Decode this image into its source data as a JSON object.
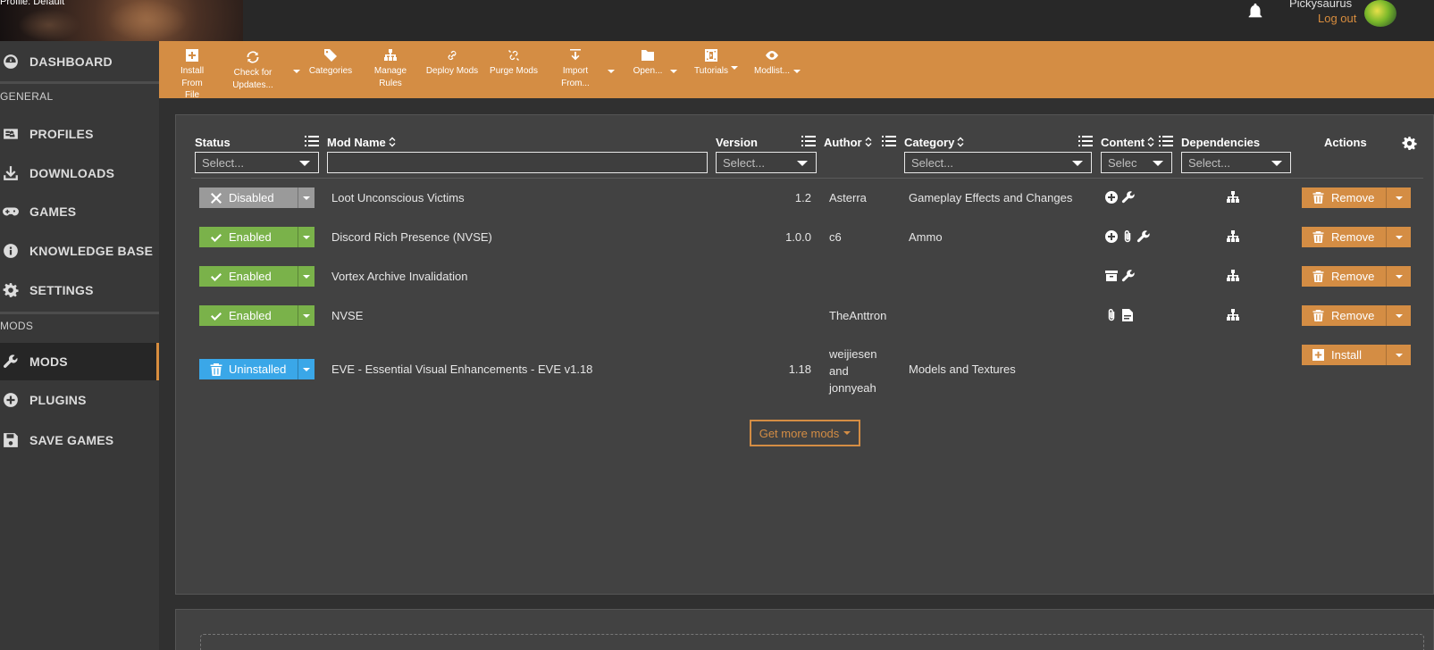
{
  "header": {
    "profile_label": "Profile: Default",
    "username": "Pickysaurus",
    "logout": "Log out"
  },
  "sidebar": {
    "items": [
      {
        "label": "DASHBOARD",
        "icon": "dashboard-icon"
      },
      {
        "label": "PROFILES",
        "icon": "profiles-icon"
      },
      {
        "label": "DOWNLOADS",
        "icon": "download-icon"
      },
      {
        "label": "GAMES",
        "icon": "gamepad-icon"
      },
      {
        "label": "KNOWLEDGE BASE",
        "icon": "info-icon"
      },
      {
        "label": "SETTINGS",
        "icon": "gear-icon"
      },
      {
        "label": "MODS",
        "icon": "wrench-icon",
        "active": true
      },
      {
        "label": "PLUGINS",
        "icon": "plus-circle-icon"
      },
      {
        "label": "SAVE GAMES",
        "icon": "floppy-icon"
      }
    ],
    "sections": {
      "general": "GENERAL",
      "mods": "MODS"
    }
  },
  "toolbar": {
    "install_from_file": [
      "Install From",
      "File"
    ],
    "check_for_updates": [
      "Check for",
      "Updates..."
    ],
    "categories": "Categories",
    "manage_rules": [
      "Manage",
      "Rules"
    ],
    "deploy_mods": "Deploy Mods",
    "purge_mods": "Purge Mods",
    "import_from": [
      "Import",
      "From..."
    ],
    "open": "Open...",
    "tutorials": "Tutorials",
    "modlist": "Modlist..."
  },
  "table": {
    "headers": {
      "status": "Status",
      "mod_name": "Mod Name",
      "version": "Version",
      "author": "Author",
      "category": "Category",
      "content": "Content",
      "dependencies": "Dependencies",
      "actions": "Actions"
    },
    "filters": {
      "status": "Select...",
      "mod_name": "",
      "version": "Select...",
      "category": "Select...",
      "content": "Selec",
      "dependencies": "Select..."
    },
    "rows": [
      {
        "status": "Disabled",
        "name": "Loot Unconscious Victims",
        "version": "1.2",
        "author": "Asterra",
        "category": "Gameplay Effects and Changes",
        "action": "Remove"
      },
      {
        "status": "Enabled",
        "name": "Discord Rich Presence (NVSE)",
        "version": "1.0.0",
        "author": "c6",
        "category": "Ammo",
        "action": "Remove"
      },
      {
        "status": "Enabled",
        "name": "Vortex Archive Invalidation",
        "version": "",
        "author": "",
        "category": "",
        "action": "Remove"
      },
      {
        "status": "Enabled",
        "name": "NVSE",
        "version": "",
        "author": "TheAnttron",
        "category": "",
        "action": "Remove"
      },
      {
        "status": "Uninstalled",
        "name": "EVE - Essential Visual Enhancements - EVE v1.18",
        "version": "1.18",
        "author_lines": [
          "weijiesen",
          "and",
          "jonnyeah"
        ],
        "category": "Models and Textures",
        "action": "Install"
      }
    ],
    "get_more": "Get more mods"
  },
  "colors": {
    "accent": "#d48d44",
    "enabled": "#7ab24a",
    "disabled": "#9a9a9a",
    "uninstalled": "#3aa7e8"
  }
}
